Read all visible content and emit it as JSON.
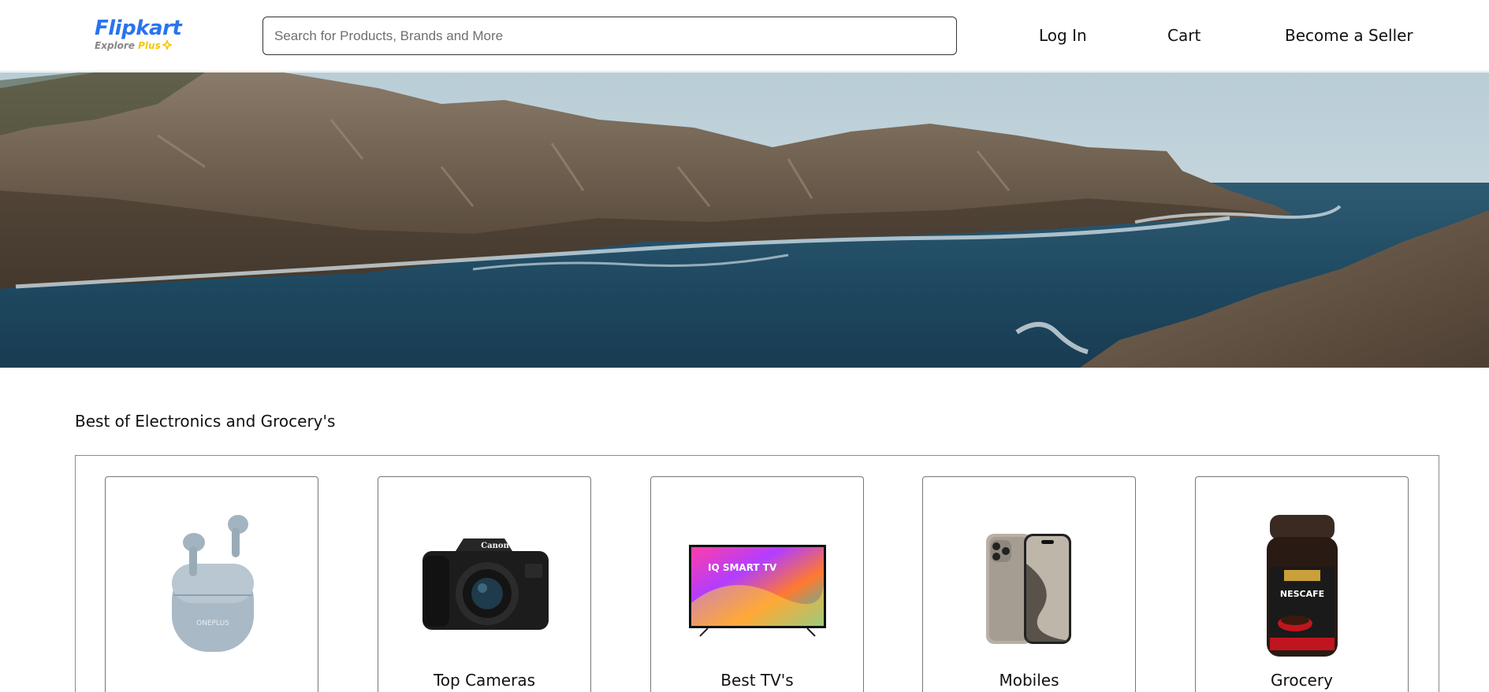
{
  "brand": {
    "name": "Flipkart",
    "tagline_prefix": "Explore ",
    "tagline_accent": "Plus",
    "primary_color": "#2874f0",
    "accent_color": "#f7c800"
  },
  "search": {
    "placeholder": "Search for Products, Brands and More",
    "value": ""
  },
  "nav": {
    "login": "Log In",
    "cart": "Cart",
    "seller": "Become a Seller"
  },
  "banner": {
    "image": "rocky-coastline-sea-photo"
  },
  "section": {
    "title": "Best of Electronics and Grocery's",
    "cards": [
      {
        "label": "",
        "icon": "earbuds-image",
        "image_text": "ONEPLUS"
      },
      {
        "label": "Top Cameras",
        "icon": "camera-image",
        "image_text": "Canon"
      },
      {
        "label": "Best TV's",
        "icon": "tv-image",
        "image_text": "IQ SMART TV"
      },
      {
        "label": "Mobiles",
        "icon": "phone-image",
        "image_text": ""
      },
      {
        "label": "Grocery",
        "icon": "coffee-jar-image",
        "image_text": "NESCAFE"
      }
    ]
  }
}
